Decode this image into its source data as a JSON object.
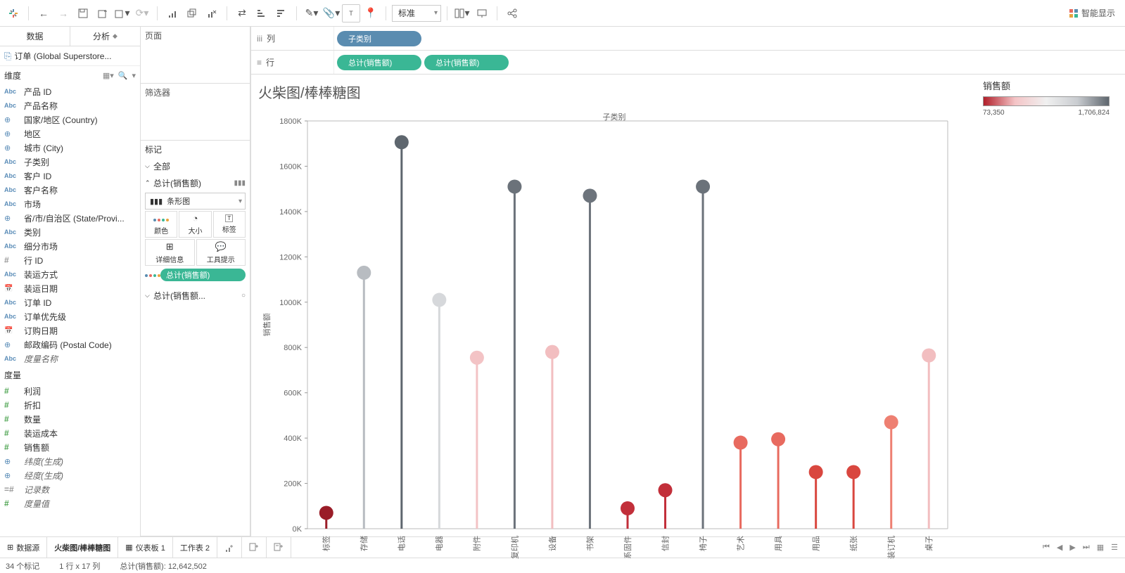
{
  "toolbar": {
    "std_label": "标准",
    "smart": "智能显示"
  },
  "data_tabs": {
    "data": "数据",
    "analysis": "分析"
  },
  "datasource": "订单 (Global Superstore...",
  "dim_header": "维度",
  "dims": [
    {
      "icon": "abc",
      "label": "产品 ID"
    },
    {
      "icon": "abc",
      "label": "产品名称"
    },
    {
      "icon": "globe",
      "label": "国家/地区 (Country)"
    },
    {
      "icon": "globe",
      "label": "地区"
    },
    {
      "icon": "globe",
      "label": "城市 (City)"
    },
    {
      "icon": "abc",
      "label": "子类别"
    },
    {
      "icon": "abc",
      "label": "客户 ID"
    },
    {
      "icon": "abc",
      "label": "客户名称"
    },
    {
      "icon": "abc",
      "label": "市场"
    },
    {
      "icon": "globe",
      "label": "省/市/自治区 (State/Provi..."
    },
    {
      "icon": "abc",
      "label": "类别"
    },
    {
      "icon": "abc",
      "label": "细分市场"
    },
    {
      "icon": "hash-grey",
      "label": "行 ID"
    },
    {
      "icon": "abc",
      "label": "装运方式"
    },
    {
      "icon": "date",
      "label": "装运日期"
    },
    {
      "icon": "abc",
      "label": "订单 ID"
    },
    {
      "icon": "abc",
      "label": "订单优先级"
    },
    {
      "icon": "date",
      "label": "订购日期"
    },
    {
      "icon": "globe",
      "label": "邮政编码 (Postal Code)"
    },
    {
      "icon": "abc",
      "label": "度量名称",
      "italic": true
    }
  ],
  "meas_header": "度量",
  "meas": [
    {
      "icon": "hash",
      "label": "利润"
    },
    {
      "icon": "hash",
      "label": "折扣"
    },
    {
      "icon": "hash",
      "label": "数量"
    },
    {
      "icon": "hash",
      "label": "装运成本"
    },
    {
      "icon": "hash",
      "label": "销售额"
    },
    {
      "icon": "globe",
      "label": "纬度(生成)",
      "italic": true
    },
    {
      "icon": "globe",
      "label": "经度(生成)",
      "italic": true
    },
    {
      "icon": "equals",
      "label": "记录数",
      "italic": true
    },
    {
      "icon": "hash",
      "label": "度量值",
      "italic": true
    }
  ],
  "mid": {
    "pages": "页面",
    "filters": "筛选器",
    "marks": "标记",
    "all": "全部",
    "sum1": "总计(销售额)",
    "bar_type": "条形图",
    "color": "颜色",
    "size": "大小",
    "label": "标签",
    "detail": "详细信息",
    "tooltip": "工具提示",
    "pill_sum": "总计(销售额)",
    "sum2": "总计(销售额..."
  },
  "shelves": {
    "cols_label": "列",
    "cols_pill": "子类别",
    "rows_label": "行",
    "rows_pill1": "总计(销售额)",
    "rows_pill2": "总计(销售额)"
  },
  "chart": {
    "title": "火柴图/棒棒糖图",
    "axis_title": "子类别",
    "y_title": "销售额"
  },
  "legend": {
    "title": "销售额",
    "min": "73,350",
    "max": "1,706,824"
  },
  "tabs": {
    "datasource": "数据源",
    "active": "火柴图/棒棒糖图",
    "dash": "仪表板 1",
    "sheet2": "工作表 2"
  },
  "status": {
    "marks": "34 个标记",
    "rows": "1 行 x 17 列",
    "sum": "总计(销售额): 12,642,502"
  },
  "chart_data": {
    "type": "bar",
    "title": "火柴图/棒棒糖图",
    "xlabel": "子类别",
    "ylabel": "销售额",
    "ylim": [
      0,
      1800000
    ],
    "y_ticks": [
      0,
      200000,
      400000,
      600000,
      800000,
      1000000,
      1200000,
      1400000,
      1600000,
      1800000
    ],
    "y_tick_labels": [
      "0K",
      "200K",
      "400K",
      "600K",
      "800K",
      "1000K",
      "1200K",
      "1400K",
      "1600K",
      "1800K"
    ],
    "categories": [
      "标签",
      "存储",
      "电话",
      "电器",
      "附件",
      "复印机",
      "设备",
      "书架",
      "系固件",
      "信封",
      "椅子",
      "艺术",
      "用具",
      "用品",
      "纸张",
      "装订机",
      "桌子"
    ],
    "values": [
      70000,
      1130000,
      1706000,
      1010000,
      755000,
      1510000,
      780000,
      1470000,
      90000,
      170000,
      1510000,
      380000,
      395000,
      250000,
      250000,
      470000,
      765000
    ],
    "colors": [
      "#9a1d28",
      "#b8bcc1",
      "#5e666e",
      "#d6d8db",
      "#f3c3c5",
      "#6b727a",
      "#f2bec0",
      "#6d747c",
      "#c22f3a",
      "#c22f3a",
      "#6b727a",
      "#e86a5f",
      "#e86a5f",
      "#d9473f",
      "#d9473f",
      "#ee8072",
      "#f2bec0"
    ],
    "color_scale": {
      "field": "销售额",
      "min": 73350,
      "max": 1706824
    }
  }
}
